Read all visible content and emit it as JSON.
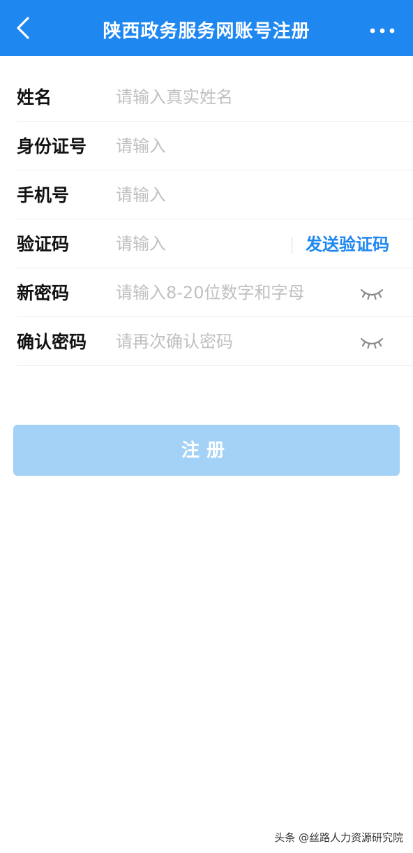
{
  "header": {
    "title": "陕西政务服务网账号注册",
    "back_icon": "chevron-left-icon",
    "more_icon": "ellipsis-icon"
  },
  "form": {
    "fields": [
      {
        "label": "姓名",
        "placeholder": "请输入真实姓名"
      },
      {
        "label": "身份证号",
        "placeholder": "请输入"
      },
      {
        "label": "手机号",
        "placeholder": "请输入"
      },
      {
        "label": "验证码",
        "placeholder": "请输入",
        "action": "发送验证码"
      },
      {
        "label": "新密码",
        "placeholder": "请输入8-20位数字和字母",
        "icon": "eye-closed-icon"
      },
      {
        "label": "确认密码",
        "placeholder": "请再次确认密码",
        "icon": "eye-closed-icon"
      }
    ]
  },
  "submit_label": "注册",
  "watermark": "头条 @丝路人力资源研究院",
  "colors": {
    "primary": "#1e87f0",
    "button_disabled": "#a3d2f6",
    "placeholder": "#c0c0c0",
    "divider": "#ececec"
  }
}
